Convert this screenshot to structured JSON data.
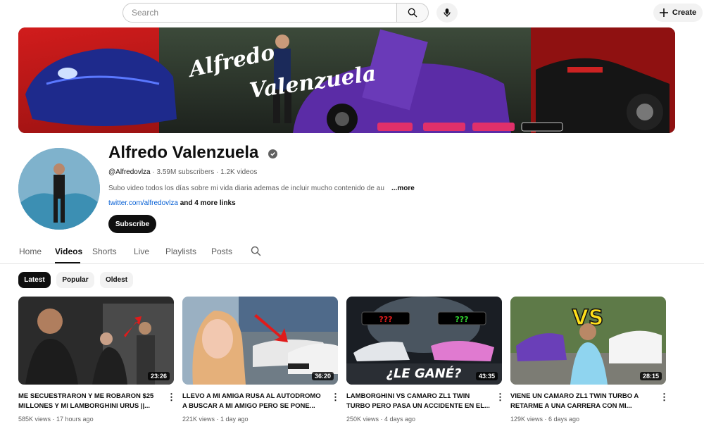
{
  "header": {
    "search_placeholder": "Search",
    "create_label": "Create"
  },
  "channel": {
    "name": "Alfredo Valenzuela",
    "handle": "@Alfredovlza",
    "subscribers": "3.59M subscribers",
    "video_count": "1.2K videos",
    "description": "Subo video todos los días sobre mi vida diaria ademas de incluir mucho contenido de au",
    "more_label": "...more",
    "link_text": "twitter.com/alfredovlza",
    "more_links": "and 4 more links",
    "subscribe_label": "Subscribe",
    "banner_script_line1": "Alfredo",
    "banner_script_line2": "Valenzuela"
  },
  "tabs": [
    {
      "label": "Home"
    },
    {
      "label": "Videos"
    },
    {
      "label": "Shorts"
    },
    {
      "label": "Live"
    },
    {
      "label": "Playlists"
    },
    {
      "label": "Posts"
    }
  ],
  "chips": [
    {
      "label": "Latest"
    },
    {
      "label": "Popular"
    },
    {
      "label": "Oldest"
    }
  ],
  "videos": [
    {
      "title": "ME SECUESTRARON Y ME ROBARON $25 MILLONES Y MI LAMBORGHINI URUS ||...",
      "duration": "23:26",
      "views": "585K views",
      "age": "17 hours ago"
    },
    {
      "title": "LLEVO A MI AMIGA RUSA AL AUTODROMO A BUSCAR A MI AMIGO PERO SE PONE...",
      "duration": "36:20",
      "views": "221K views",
      "age": "1 day ago"
    },
    {
      "title": "LAMBORGHINI VS CAMARO ZL1 TWIN TURBO PERO PASA UN ACCIDENTE EN EL...",
      "duration": "43:35",
      "views": "250K views",
      "age": "4 days ago",
      "thumb_text": "¿LE GANÉ?"
    },
    {
      "title": "VIENE UN CAMARO ZL1 TWIN TURBO A RETARME A UNA CARRERA CON MI...",
      "duration": "28:15",
      "views": "129K views",
      "age": "6 days ago",
      "thumb_text": "VS"
    }
  ],
  "colors": {
    "accent_red": "#cc1a1a",
    "link_blue": "#065fd4",
    "subscribe_bg": "#0f0f0f"
  }
}
